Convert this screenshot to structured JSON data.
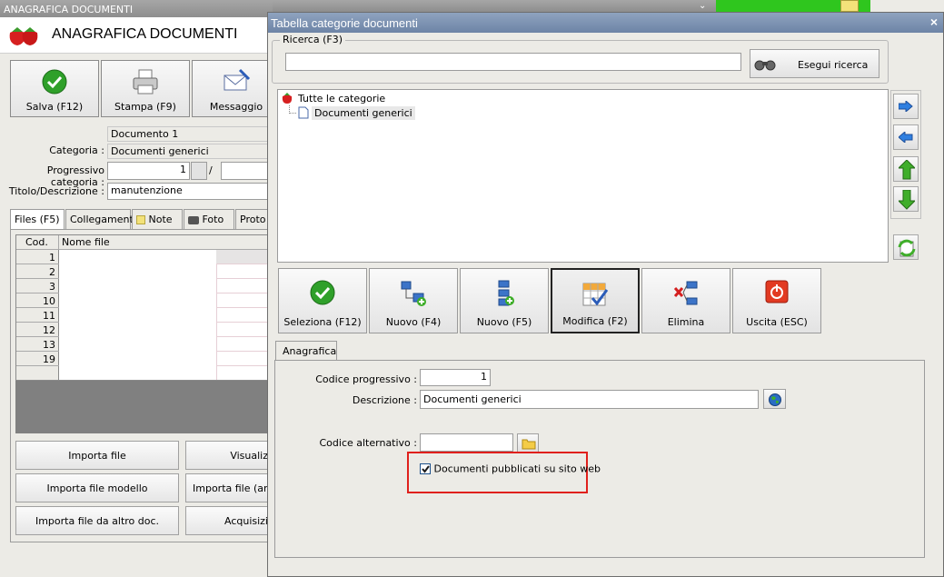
{
  "bg": {
    "window_title": "ANAGRAFICA DOCUMENTI",
    "header_title": "ANAGRAFICA DOCUMENTI",
    "toolbar": {
      "save": "Salva (F12)",
      "print": "Stampa (F9)",
      "message": "Messaggio"
    },
    "form": {
      "doc_value": "Documento 1",
      "category_label": "Categoria :",
      "category_value": "Documenti generici",
      "progressive_label": "Progressivo categoria :",
      "progressive_value": "1",
      "slash": "/",
      "title_label": "Titolo/Descrizione :",
      "title_value": "manutenzione"
    },
    "tabs": [
      "Files (F5)",
      "Collegamenti",
      "Note",
      "Foto",
      "Proto"
    ],
    "files_table": {
      "headers": [
        "Cod.",
        "Nome file"
      ],
      "rows": [
        "1",
        "2",
        "3",
        "10",
        "11",
        "12",
        "13",
        "19"
      ]
    },
    "buttons": {
      "import_file": "Importa file",
      "import_template": "Importa file modello",
      "import_other": "Importa file da altro doc.",
      "view": "Visualiz",
      "import_file_an": "Importa file (an",
      "acquire": "Acquisizi"
    }
  },
  "dialog": {
    "title": "Tabella categorie documenti",
    "close": "×",
    "search": {
      "legend": "Ricerca (F3)",
      "value": "",
      "button": "Esegui ricerca"
    },
    "tree": {
      "root": "Tutte le categorie",
      "child": "Documenti generici"
    },
    "toolbar": [
      {
        "label": "Seleziona (F12)",
        "icon": "check-icon"
      },
      {
        "label": "Nuovo (F4)",
        "icon": "new-node-icon"
      },
      {
        "label": "Nuovo (F5)",
        "icon": "new-child-icon"
      },
      {
        "label": "Modifica (F2)",
        "icon": "edit-icon"
      },
      {
        "label": "Elimina",
        "icon": "delete-node-icon"
      },
      {
        "label": "Uscita (ESC)",
        "icon": "exit-icon"
      }
    ],
    "tab": "Anagrafica",
    "form": {
      "code_label": "Codice progressivo :",
      "code_value": "1",
      "desc_label": "Descrizione :",
      "desc_value": "Documenti generici",
      "alt_label": "Codice alternativo :",
      "alt_value": "",
      "publish_label": "Documenti pubblicati su sito web",
      "publish_checked": true
    }
  },
  "colors": {
    "highlight_box": "#e0201c",
    "dialog_title": "#7b90b0",
    "arrow_blue": "#2f7fe0",
    "arrow_green": "#3fae2a"
  }
}
